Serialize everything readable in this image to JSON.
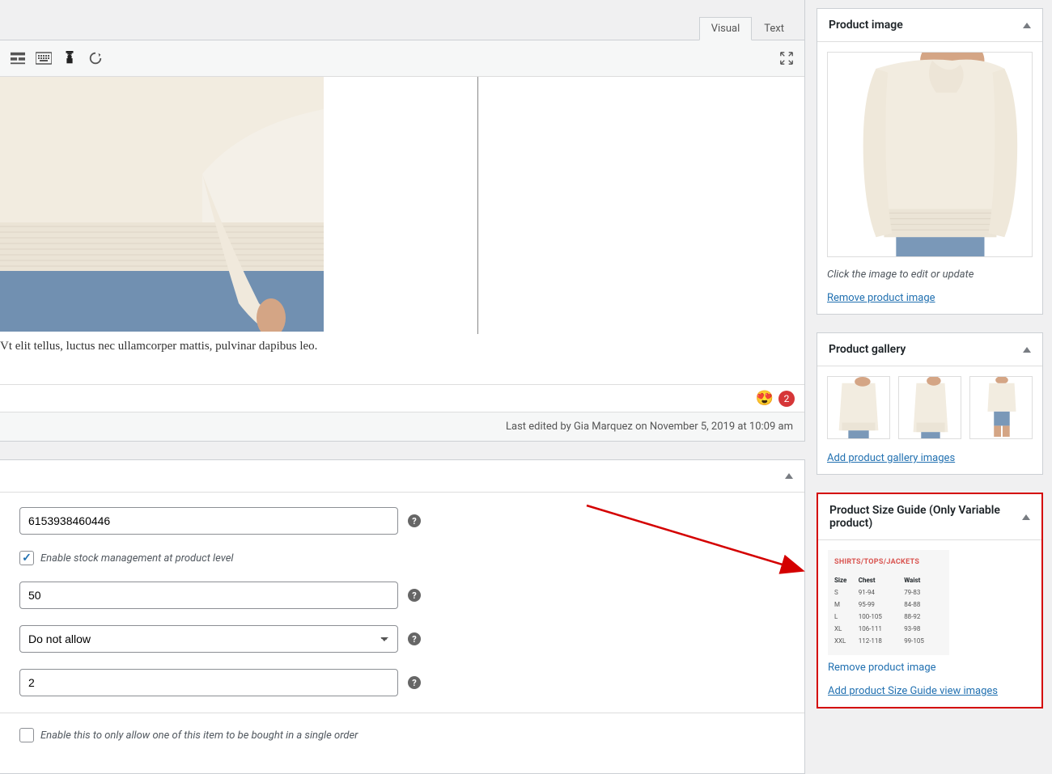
{
  "editor": {
    "tabs": {
      "visual": "Visual",
      "text": "Text"
    },
    "content_text": "Vt elit tellus, luctus nec ullamcorper mattis, pulvinar dapibus leo.",
    "emoji_count": "2",
    "last_edited": "Last edited by Gia Marquez on November 5, 2019 at 10:09 am"
  },
  "form": {
    "sku": "6153938460446",
    "stock_mgmt_label": "Enable stock management at product level",
    "stock_qty": "50",
    "backorder": "Do not allow",
    "low_stock": "2",
    "sold_individually_label": "Enable this to only allow one of this item to be bought in a single order"
  },
  "sidebar": {
    "product_image": {
      "title": "Product image",
      "caption": "Click the image to edit or update",
      "remove": "Remove product image"
    },
    "product_gallery": {
      "title": "Product gallery",
      "add": "Add product gallery images"
    },
    "size_guide": {
      "title": "Product Size Guide (Only Variable product)",
      "remove": "Remove product image",
      "add": "Add product Size Guide view images"
    }
  },
  "chart_data": {
    "type": "table",
    "title": "SHIRTS/TOPS/JACKETS",
    "columns": [
      "Size",
      "Chest",
      "Waist"
    ],
    "rows": [
      [
        "S",
        "91-94",
        "79-83"
      ],
      [
        "M",
        "95-99",
        "84-88"
      ],
      [
        "L",
        "100-105",
        "88-92"
      ],
      [
        "XL",
        "106-111",
        "93-98"
      ],
      [
        "XXL",
        "112-118",
        "99-105"
      ]
    ]
  }
}
